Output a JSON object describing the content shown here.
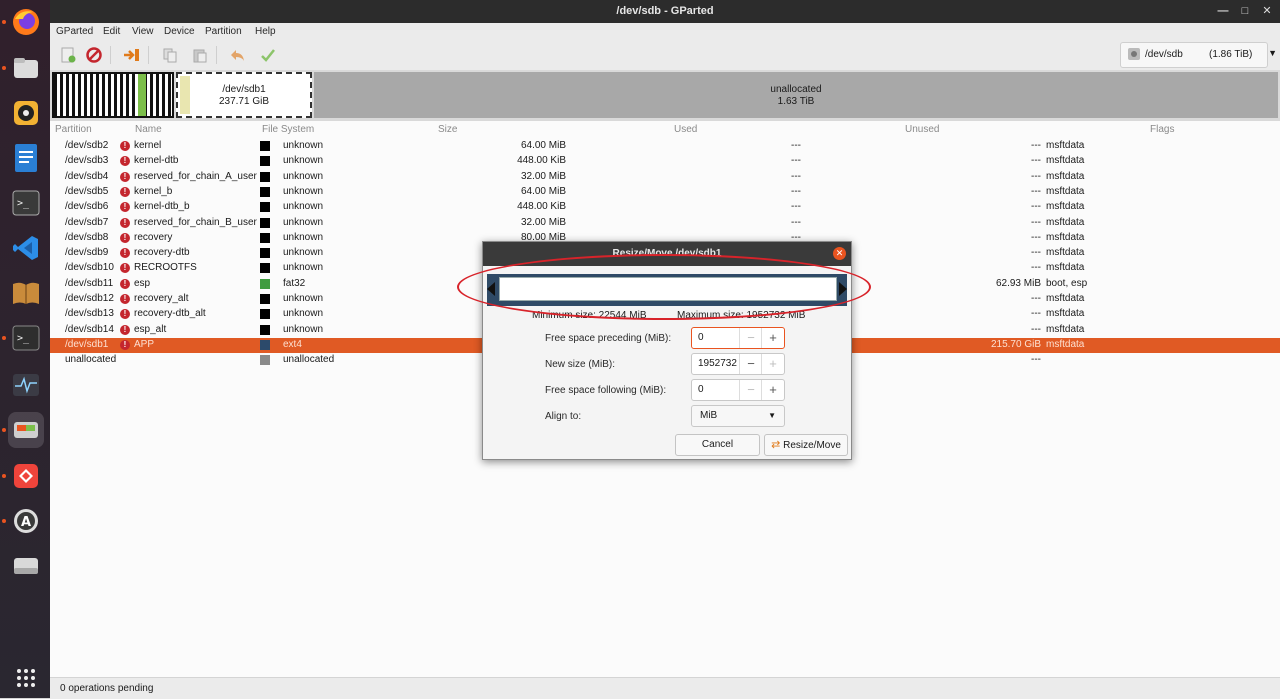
{
  "window": {
    "title": "/dev/sdb - GParted"
  },
  "menu": [
    "GParted",
    "Edit",
    "View",
    "Device",
    "Partition",
    "Help"
  ],
  "toolbar": {
    "device": "/dev/sdb",
    "device_size": "(1.86 TiB)"
  },
  "map": {
    "sdb1_name": "/dev/sdb1",
    "sdb1_size": "237.71 GiB",
    "unalloc_name": "unallocated",
    "unalloc_size": "1.63 TiB"
  },
  "table": {
    "headers": [
      "Partition",
      "Name",
      "File System",
      "Size",
      "Used",
      "Unused",
      "Flags"
    ],
    "rows": [
      {
        "partition": "/dev/sdb2",
        "name": "kernel",
        "fs": "unknown",
        "size": "64.00 MiB",
        "used": "---",
        "unused": "---",
        "flags": "msftdata"
      },
      {
        "partition": "/dev/sdb3",
        "name": "kernel-dtb",
        "fs": "unknown",
        "size": "448.00 KiB",
        "used": "---",
        "unused": "---",
        "flags": "msftdata"
      },
      {
        "partition": "/dev/sdb4",
        "name": "reserved_for_chain_A_user",
        "fs": "unknown",
        "size": "32.00 MiB",
        "used": "---",
        "unused": "---",
        "flags": "msftdata"
      },
      {
        "partition": "/dev/sdb5",
        "name": "kernel_b",
        "fs": "unknown",
        "size": "64.00 MiB",
        "used": "---",
        "unused": "---",
        "flags": "msftdata"
      },
      {
        "partition": "/dev/sdb6",
        "name": "kernel-dtb_b",
        "fs": "unknown",
        "size": "448.00 KiB",
        "used": "---",
        "unused": "---",
        "flags": "msftdata"
      },
      {
        "partition": "/dev/sdb7",
        "name": "reserved_for_chain_B_user",
        "fs": "unknown",
        "size": "32.00 MiB",
        "used": "---",
        "unused": "---",
        "flags": "msftdata"
      },
      {
        "partition": "/dev/sdb8",
        "name": "recovery",
        "fs": "unknown",
        "size": "80.00 MiB",
        "used": "---",
        "unused": "---",
        "flags": "msftdata"
      },
      {
        "partition": "/dev/sdb9",
        "name": "recovery-dtb",
        "fs": "unknown",
        "size": "",
        "used": "---",
        "unused": "---",
        "flags": "msftdata"
      },
      {
        "partition": "/dev/sdb10",
        "name": "RECROOTFS",
        "fs": "unknown",
        "size": "",
        "used": "---",
        "unused": "---",
        "flags": "msftdata"
      },
      {
        "partition": "/dev/sdb11",
        "name": "esp",
        "fs": "fat32",
        "size": "",
        "used": "",
        "unused": "62.93 MiB",
        "flags": "boot, esp"
      },
      {
        "partition": "/dev/sdb12",
        "name": "recovery_alt",
        "fs": "unknown",
        "size": "",
        "used": "---",
        "unused": "---",
        "flags": "msftdata"
      },
      {
        "partition": "/dev/sdb13",
        "name": "recovery-dtb_alt",
        "fs": "unknown",
        "size": "",
        "used": "---",
        "unused": "---",
        "flags": "msftdata"
      },
      {
        "partition": "/dev/sdb14",
        "name": "esp_alt",
        "fs": "unknown",
        "size": "",
        "used": "---",
        "unused": "---",
        "flags": "msftdata"
      },
      {
        "partition": "/dev/sdb1",
        "name": "APP",
        "fs": "ext4",
        "size": "",
        "used": "",
        "unused": "215.70 GiB",
        "flags": "msftdata"
      },
      {
        "partition": "unallocated",
        "name": "",
        "fs": "unallocated",
        "size": "",
        "used": "",
        "unused": "---",
        "flags": ""
      }
    ]
  },
  "status": "0 operations pending",
  "dialog": {
    "title": "Resize/Move /dev/sdb1",
    "min_size": "Minimum size: 22544 MiB",
    "max_size": "Maximum size: 1952732 MiB",
    "preceding_label": "Free space preceding (MiB):",
    "preceding_value": "0",
    "newsize_label": "New size (MiB):",
    "newsize_value": "1952732",
    "following_label": "Free space following (MiB):",
    "following_value": "0",
    "align_label": "Align to:",
    "align_value": "MiB",
    "cancel": "Cancel",
    "resize": "Resize/Move"
  },
  "colors": {
    "accent": "#e95420",
    "selected_row": "#e05a24",
    "annotation": "#d8232a",
    "dialog_bar": "#2f4a66"
  }
}
